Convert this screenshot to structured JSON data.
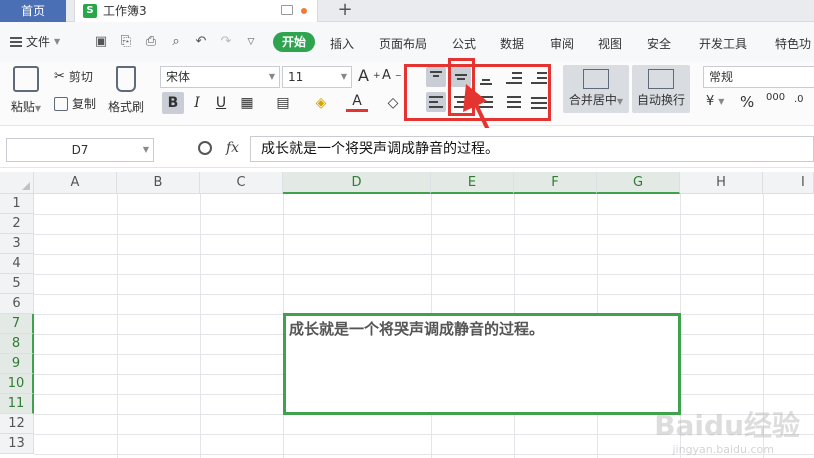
{
  "tabs": {
    "home": "首页",
    "workbook": "工作簿3",
    "workbook_logo": "S"
  },
  "menu": {
    "file": "文件",
    "start": "开始",
    "items": [
      "插入",
      "页面布局",
      "公式",
      "数据",
      "审阅",
      "视图",
      "安全",
      "开发工具",
      "特色功"
    ]
  },
  "ribbon": {
    "paste": "粘贴",
    "cut": "剪切",
    "copy": "复制",
    "format_painter": "格式刷",
    "font_name": "宋体",
    "font_size": "11",
    "bold": "B",
    "italic": "I",
    "underline": "U",
    "font_color_glyph": "A",
    "merge_center": "合并居中",
    "wrap_text": "自动换行",
    "number_format": "常规",
    "percent": "%",
    "thousands": "000"
  },
  "formula_bar": {
    "cell_ref": "D7",
    "fx": "fx",
    "content": "成长就是一个将哭声调成静音的过程。"
  },
  "sheet": {
    "columns": [
      "A",
      "B",
      "C",
      "D",
      "E",
      "F",
      "G",
      "H",
      "I"
    ],
    "rows": [
      "1",
      "2",
      "3",
      "4",
      "5",
      "6",
      "7",
      "8",
      "9",
      "10",
      "11",
      "12",
      "13"
    ],
    "selected_column_range": [
      "D",
      "G"
    ],
    "selected_row_range": [
      "7",
      "11"
    ],
    "merged_cell_text": "成长就是一个将哭声调成静音的过程。"
  },
  "watermark": {
    "brand": "Baidu经验",
    "url": "jingyan.baidu.com"
  },
  "colors": {
    "accent_green": "#2ea44f",
    "selection_green": "#3fa34d",
    "annotation_red": "#e4342f",
    "home_tab_blue": "#4a6fb5"
  }
}
